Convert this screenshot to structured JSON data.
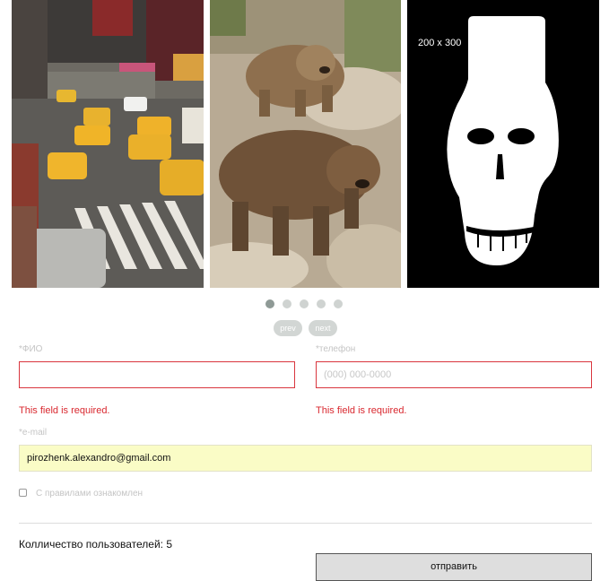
{
  "carousel": {
    "slides": [
      {
        "name": "city-street-photo"
      },
      {
        "name": "bears-photo"
      },
      {
        "name": "skull-placeholder",
        "placeholder_label": "200 x 300"
      }
    ],
    "dot_count": 5,
    "active_dot": 0,
    "prev_label": "prev",
    "next_label": "next"
  },
  "form": {
    "fio": {
      "label": "*ФИО",
      "value": "",
      "placeholder": "",
      "error": "This field is required."
    },
    "phone": {
      "label": "*телефон",
      "value": "",
      "placeholder": "(000) 000-0000",
      "error": "This field is required."
    },
    "email": {
      "label": "*e-mail",
      "value": "pirozhenk.alexandro@gmail.com"
    },
    "agree": {
      "label": "С правилами ознакомлен",
      "checked": false
    },
    "users_count_text": "Колличество пользователей: 5",
    "submit_label": "отправить"
  },
  "colors": {
    "error": "#d9282f",
    "autofill_bg": "#fafcc6",
    "dot_active": "#8f9a96",
    "dot_inactive": "#cfd3d1"
  }
}
